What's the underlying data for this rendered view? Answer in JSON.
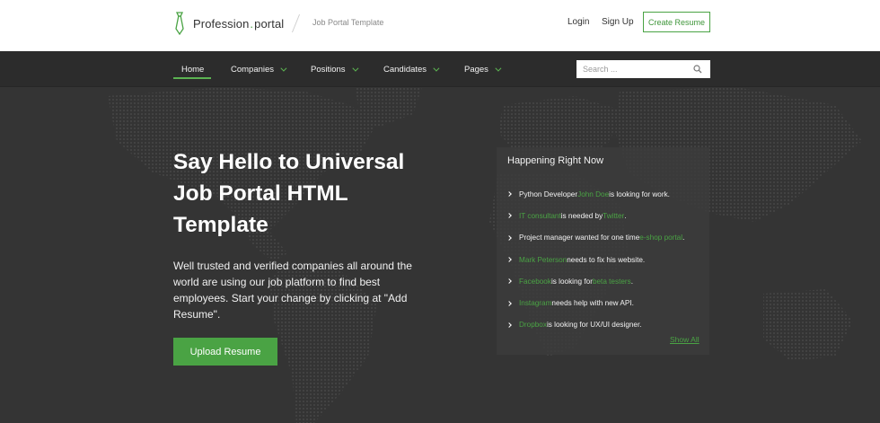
{
  "header": {
    "logo_main": "Profession",
    "logo_dot": ".",
    "logo_suffix": "portal",
    "tagline": "Job Portal Template",
    "login": "Login",
    "signup": "Sign Up",
    "create_resume": "Create Resume"
  },
  "nav": {
    "items": [
      {
        "label": "Home",
        "dropdown": false,
        "active": true
      },
      {
        "label": "Companies",
        "dropdown": true
      },
      {
        "label": "Positions",
        "dropdown": true
      },
      {
        "label": "Candidates",
        "dropdown": true
      },
      {
        "label": "Pages",
        "dropdown": true
      }
    ],
    "search_placeholder": "Search ...",
    "search_icon": "search-icon"
  },
  "hero": {
    "title": "Say Hello to Universal Job Portal HTML Template",
    "description": "Well trusted and verified companies all around the world are using our job platform to find best employees. Start your change by clicking at \"Add Resume\".",
    "upload_button": "Upload Resume"
  },
  "happening": {
    "title": "Happening Right Now",
    "feed": [
      {
        "pre": "Python Developer ",
        "link": "John Doe",
        "mid": " is looking for work.",
        "link2": "",
        "post": ""
      },
      {
        "pre": "",
        "link": "IT consultant",
        "mid": " is needed by ",
        "link2": "Twitter",
        "post": "."
      },
      {
        "pre": "Project manager wanted for one time ",
        "link": "e-shop portal",
        "mid": ".",
        "link2": "",
        "post": ""
      },
      {
        "pre": "",
        "link": "Mark Peterson",
        "mid": " needs to fix his website.",
        "link2": "",
        "post": ""
      },
      {
        "pre": "",
        "link": "Facebook",
        "mid": " is looking for ",
        "link2": "beta testers",
        "post": "."
      },
      {
        "pre": "",
        "link": "Instagram",
        "mid": " needs help with new API.",
        "link2": "",
        "post": ""
      },
      {
        "pre": "",
        "link": "Dropbox",
        "mid": " is looking for UX/UI designer.",
        "link2": "",
        "post": ""
      }
    ],
    "show_all": "Show All"
  },
  "colors": {
    "accent": "#4aa344",
    "nav_bg": "#2c2c2c",
    "hero_bg": "#343434"
  }
}
